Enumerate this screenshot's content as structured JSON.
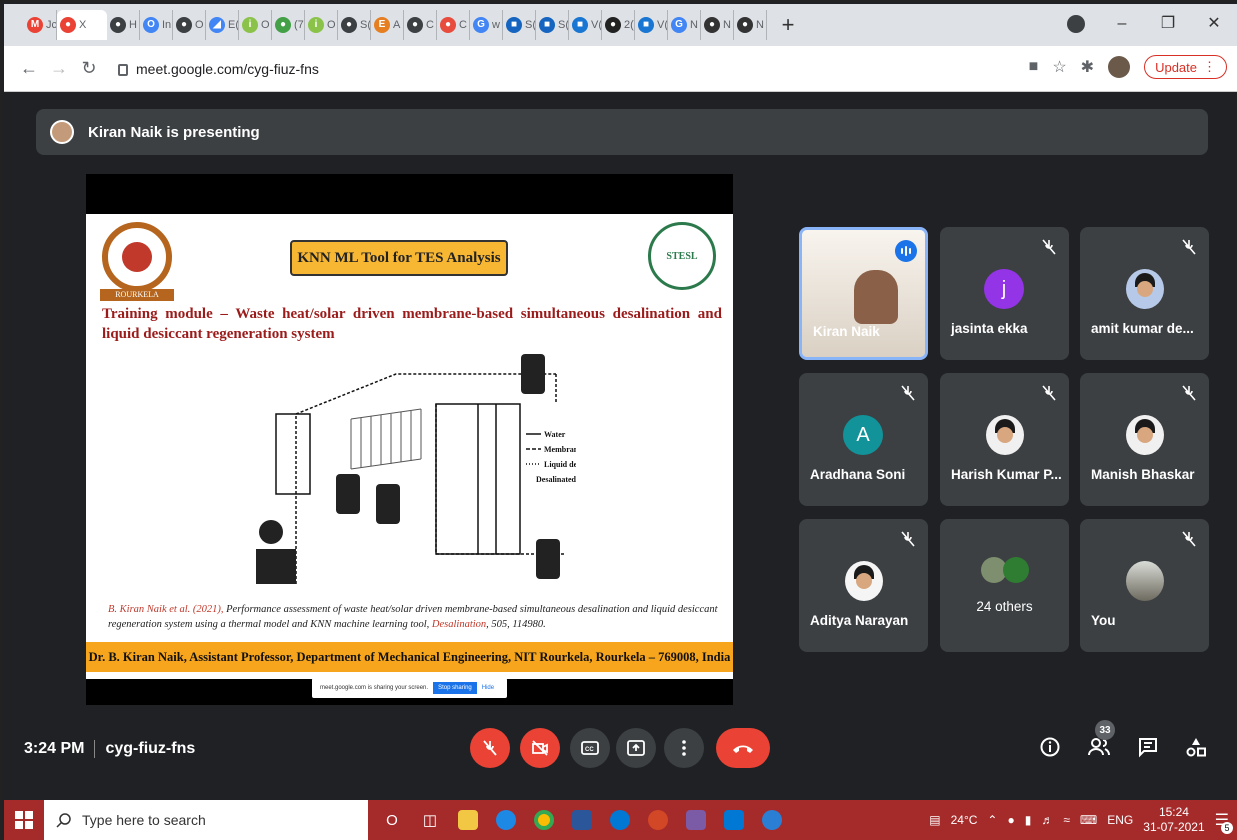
{
  "browser": {
    "tabs": [
      {
        "label": "Jc",
        "color": "#ea4335",
        "glyph": "M"
      },
      {
        "label": "X",
        "color": "#ea4335",
        "glyph": "●"
      },
      {
        "label": "H",
        "color": "#3c4043",
        "glyph": "●"
      },
      {
        "label": "In",
        "color": "#4285f4",
        "glyph": "O"
      },
      {
        "label": "O",
        "color": "#3c4043",
        "glyph": "●"
      },
      {
        "label": "E(",
        "color": "#4285f4",
        "glyph": "◢"
      },
      {
        "label": "O",
        "color": "#8bc34a",
        "glyph": "i"
      },
      {
        "label": "(7",
        "color": "#43a047",
        "glyph": "●"
      },
      {
        "label": "O",
        "color": "#8bc34a",
        "glyph": "i"
      },
      {
        "label": "S(",
        "color": "#3c4043",
        "glyph": "●"
      },
      {
        "label": "A",
        "color": "#e67e22",
        "glyph": "E"
      },
      {
        "label": "C",
        "color": "#3c4043",
        "glyph": "●"
      },
      {
        "label": "C",
        "color": "#e74c3c",
        "glyph": "●"
      },
      {
        "label": "w",
        "color": "#4285f4",
        "glyph": "G"
      },
      {
        "label": "S(",
        "color": "#1565c0",
        "glyph": "■"
      },
      {
        "label": "S(",
        "color": "#1565c0",
        "glyph": "■"
      },
      {
        "label": "V(",
        "color": "#1976d2",
        "glyph": "■"
      },
      {
        "label": "2(",
        "color": "#222",
        "glyph": "●"
      },
      {
        "label": "V(",
        "color": "#1976d2",
        "glyph": "■"
      },
      {
        "label": "N",
        "color": "#4285f4",
        "glyph": "G"
      },
      {
        "label": "N",
        "color": "#333",
        "glyph": "●"
      },
      {
        "label": "N",
        "color": "#333",
        "glyph": "●"
      }
    ],
    "new_tab": "+",
    "url": "meet.google.com/cyg-fiuz-fns",
    "update_label": "Update"
  },
  "meet": {
    "presenting_text": "Kiran Naik is presenting",
    "slide": {
      "title": "KNN ML Tool for TES Analysis",
      "left_logo_text": "ROURKELA",
      "right_logo_text": "STESL",
      "training": "Training module – Waste heat/solar driven membrane-based simultaneous desalination and liquid desiccant regeneration system",
      "citation_author": "B. Kiran Naik et al. (2021),",
      "citation_body": " Performance assessment of waste heat/solar driven membrane-based simultaneous desalination and liquid desiccant regeneration system using a thermal model and KNN machine learning tool,",
      "citation_journal": " Desalination",
      "citation_tail": ", 505, 114980.",
      "footer": "Dr. B. Kiran Naik, Assistant Professor, Department of Mechanical Engineering, NIT Rourkela, Rourkela – 769008, India",
      "share_text": "meet.google.com is sharing your screen.",
      "stop_sharing": "Stop sharing",
      "hide": "Hide",
      "legend": [
        "Water",
        "Membrane",
        "Liquid desiccant",
        "Desalinated water generation"
      ]
    },
    "participants": [
      {
        "name": "Kiran Naik",
        "type": "video"
      },
      {
        "name": "jasinta ekka",
        "initial": "j",
        "color": "#9334e6"
      },
      {
        "name": "amit kumar de...",
        "type": "photo"
      },
      {
        "name": "Aradhana Soni",
        "initial": "A",
        "color": "#12939a"
      },
      {
        "name": "Harish Kumar P...",
        "type": "photo"
      },
      {
        "name": "Manish Bhaskar",
        "type": "photo"
      },
      {
        "name": "Aditya Narayan",
        "type": "avatar"
      },
      {
        "name": "24 others",
        "type": "group"
      },
      {
        "name": "You",
        "type": "photo"
      }
    ],
    "time": "3:24 PM",
    "meeting_code": "cyg-fiuz-fns",
    "participant_count": "33"
  },
  "taskbar": {
    "search_placeholder": "Type here to search",
    "weather": "24°C",
    "lang": "ENG",
    "clock_time": "15:24",
    "clock_date": "31-07-2021",
    "notif_count": "5"
  }
}
